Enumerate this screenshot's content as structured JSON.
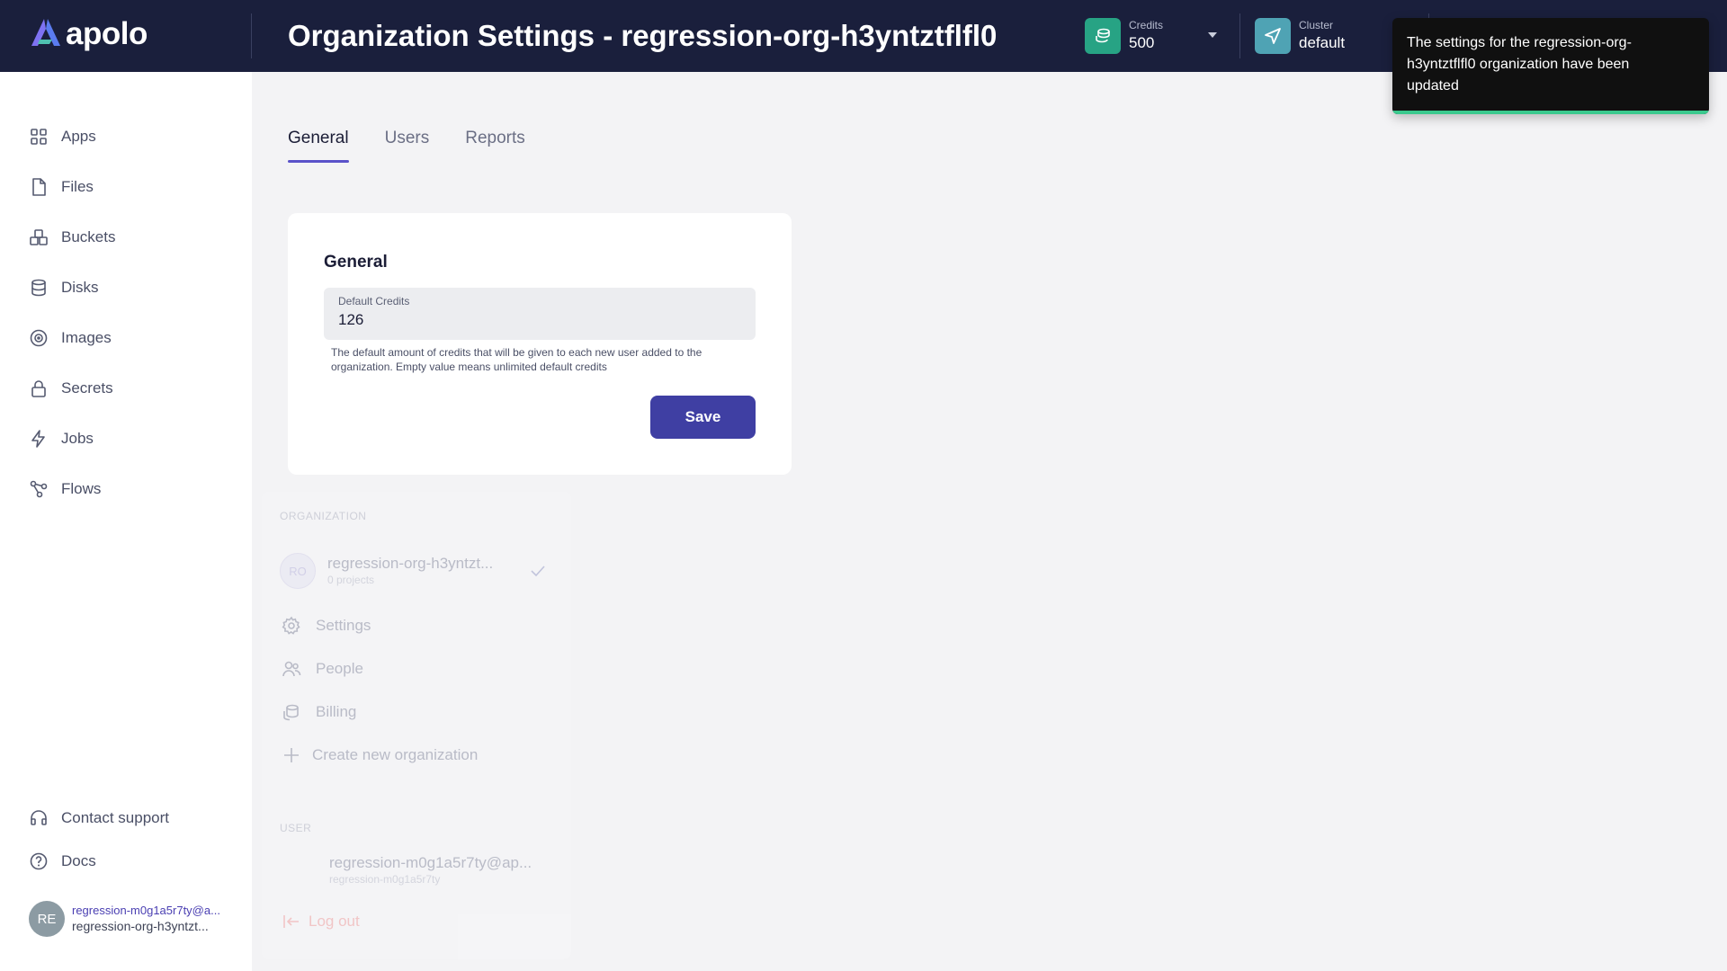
{
  "header": {
    "logo_text": "apolo",
    "title": "Organization Settings - regression-org-h3yntztflfl0",
    "credits_label": "Credits",
    "credits_value": "500",
    "cluster_label": "Cluster",
    "cluster_value": "default"
  },
  "toast": {
    "message": "The settings for the regression-org-h3yntztflfl0 organization have been updated"
  },
  "sidebar": {
    "items": [
      {
        "label": "Apps",
        "icon": "apps-icon"
      },
      {
        "label": "Files",
        "icon": "file-icon"
      },
      {
        "label": "Buckets",
        "icon": "buckets-icon"
      },
      {
        "label": "Disks",
        "icon": "database-icon"
      },
      {
        "label": "Images",
        "icon": "images-icon"
      },
      {
        "label": "Secrets",
        "icon": "lock-icon"
      },
      {
        "label": "Jobs",
        "icon": "bolt-icon"
      },
      {
        "label": "Flows",
        "icon": "flows-icon"
      }
    ],
    "support_label": "Contact support",
    "docs_label": "Docs",
    "user": {
      "initials": "RE",
      "email": "regression-m0g1a5r7ty@a...",
      "org": "regression-org-h3yntzt..."
    }
  },
  "tabs": [
    {
      "label": "General",
      "active": true
    },
    {
      "label": "Users",
      "active": false
    },
    {
      "label": "Reports",
      "active": false
    }
  ],
  "card": {
    "title": "General",
    "field_label": "Default Credits",
    "field_value": "126",
    "helper_text": "The default amount of credits that will be given to each new user added to the organization. Empty value means unlimited default credits",
    "save_label": "Save"
  },
  "org_panel": {
    "org_heading": "ORGANIZATION",
    "org_initials": "RO",
    "org_name": "regression-org-h3yntzt...",
    "org_projects": "0 projects",
    "settings_label": "Settings",
    "people_label": "People",
    "billing_label": "Billing",
    "create_label": "Create new organization",
    "user_heading": "USER",
    "user_email": "regression-m0g1a5r7ty@ap...",
    "user_name": "regression-m0g1a5r7ty",
    "logout_label": "Log out"
  },
  "colors": {
    "header_bg": "#1a1f3c",
    "accent": "#3f3fa3",
    "toast_bar": "#3bc98e"
  }
}
